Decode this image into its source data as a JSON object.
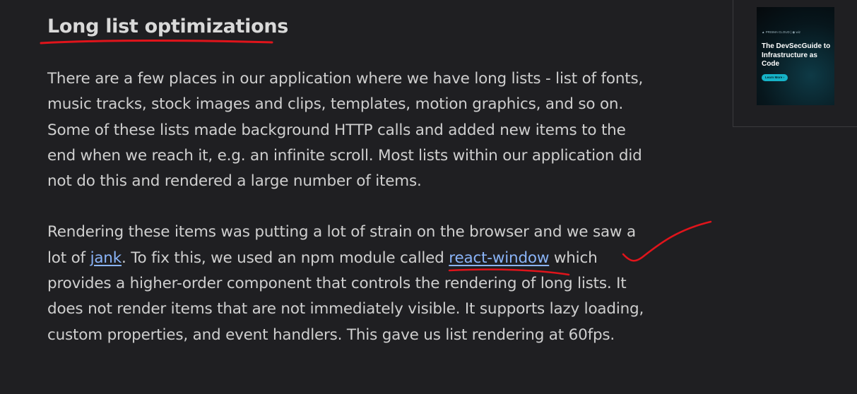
{
  "article": {
    "title": "Long list optimizations",
    "paragraph1": "There are a few places in our application where we have long lists - list of fonts, music tracks, stock images and clips, templates, motion graphics, and so on. Some of these lists made background HTTP calls and added new items to the end when we reach it, e.g. an infinite scroll. Most lists within our application did not do this and rendered a large number of items.",
    "paragraph2": {
      "text_1": "Rendering these items was putting a lot of strain on the browser and we saw a lot of ",
      "link_jank": "jank",
      "text_2": ". To fix this, we used an npm module called ",
      "link_react_window": "react-window",
      "text_3": " which provides a higher-order component that controls the rendering of long lists. It does not render items that are not immediately visible. It supports lazy loading, custom properties, and event handlers. This gave us list rendering at 60fps."
    }
  },
  "sidebar_ad": {
    "brand": "▲ PRISMA CLOUD  | ◉ wiz",
    "headline": "The DevSecGuide to Infrastructure as Code",
    "cta": "Learn More ›"
  },
  "colors": {
    "background": "#1f1f22",
    "text": "#cfcfcf",
    "link": "#8ab4f8",
    "annotation": "#e0141b"
  }
}
